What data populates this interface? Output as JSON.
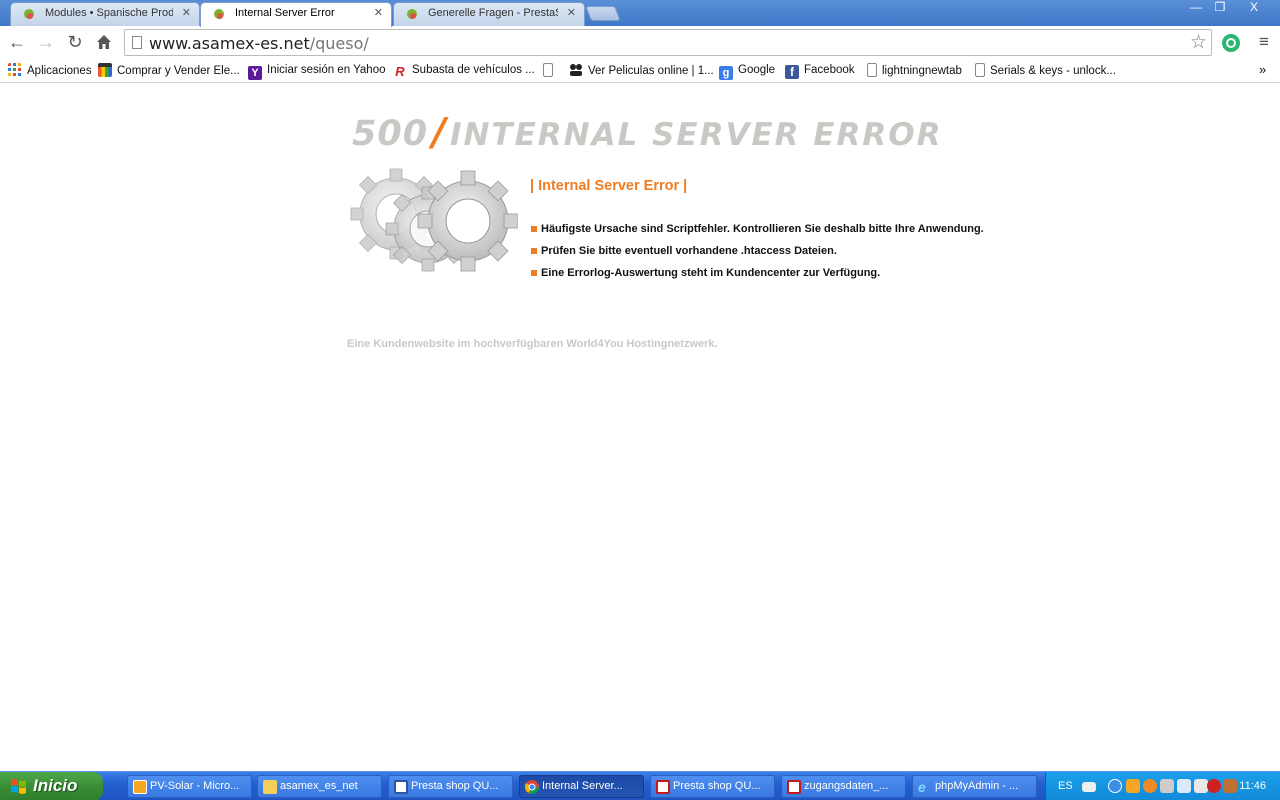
{
  "browser": {
    "tabs": [
      {
        "title": "Modules • Spanische Produkt",
        "active": false
      },
      {
        "title": "Internal Server Error",
        "active": true
      },
      {
        "title": "Generelle Fragen - PrestaSh",
        "active": false
      }
    ],
    "window_controls": {
      "minimize": "—",
      "restore": "❐",
      "close": "X"
    },
    "url_host": "www.asamex-es.net",
    "url_path": "/queso/"
  },
  "bookmarks": [
    {
      "label": "Aplicaciones",
      "icon": "apps-grid-icon"
    },
    {
      "label": "Comprar y Vender Ele...",
      "icon": "shop-bag-icon"
    },
    {
      "label": "Iniciar sesión en Yahoo",
      "icon": "yahoo-icon"
    },
    {
      "label": "Subasta de vehículos ...",
      "icon": "r-logo-icon"
    },
    {
      "label": "",
      "icon": "page-icon"
    },
    {
      "label": "Ver Peliculas online | 1...",
      "icon": "people-icon"
    },
    {
      "label": "Google",
      "icon": "google-icon"
    },
    {
      "label": "Facebook",
      "icon": "facebook-icon"
    },
    {
      "label": "lightningnewtab",
      "icon": "page-icon"
    },
    {
      "label": "Serials & keys - unlock...",
      "icon": "page-icon"
    }
  ],
  "bookmarks_overflow": "»",
  "page": {
    "code": "500",
    "slash": "/",
    "heading": "INTERNAL SERVER ERROR",
    "subheading": "| Internal Server Error |",
    "bullets": [
      "Häufigste Ursache sind Scriptfehler. Kontrollieren Sie deshalb bitte Ihre Anwendung.",
      "Prüfen Sie bitte eventuell vorhandene .htaccess Dateien.",
      "Eine Errorlog-Auswertung steht im Kundencenter zur Verfügung."
    ],
    "footer": "Eine Kundenwebsite im hochverfügbaren World4You Hostingnetzwerk."
  },
  "taskbar": {
    "start_label": "Inicio",
    "tasks": [
      {
        "label": "PV-Solar - Micro...",
        "icon": "outlook-icon",
        "active": false
      },
      {
        "label": "asamex_es_net",
        "icon": "folder-icon",
        "active": false
      },
      {
        "label": "Presta shop QU...",
        "icon": "word-icon",
        "active": false
      },
      {
        "label": "Internal Server...",
        "icon": "chrome-icon",
        "active": true
      },
      {
        "label": "Presta shop QU...",
        "icon": "pdf-icon",
        "active": false
      },
      {
        "label": "zugangsdaten_...",
        "icon": "pdf-icon",
        "active": false
      },
      {
        "label": "phpMyAdmin - ...",
        "icon": "ie-icon",
        "active": false
      }
    ],
    "language": "ES",
    "clock": "11:46"
  }
}
